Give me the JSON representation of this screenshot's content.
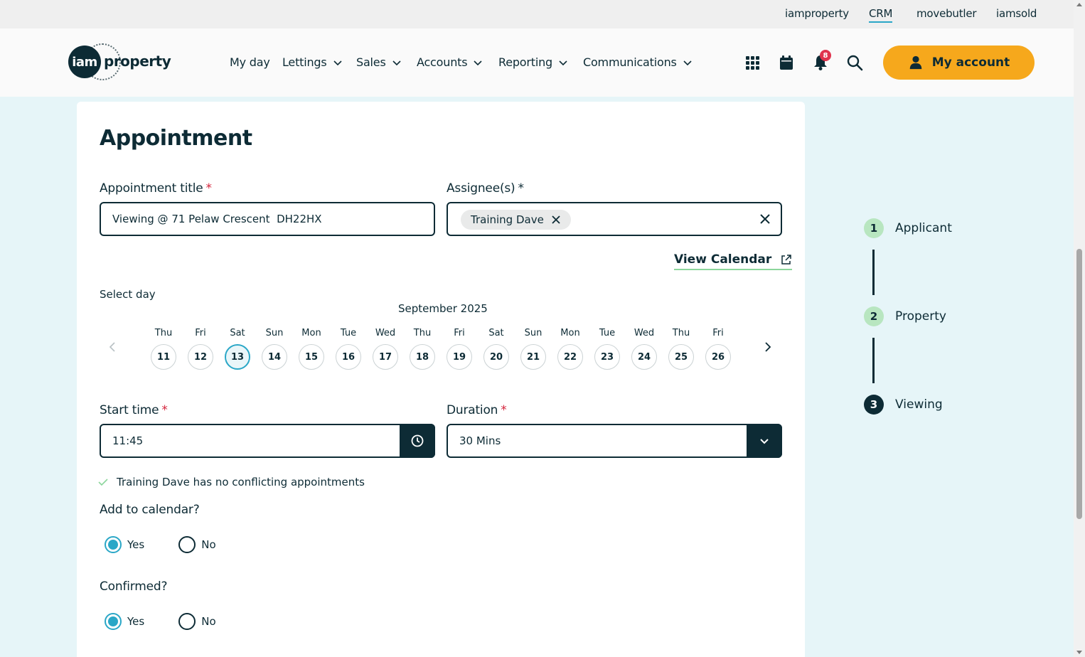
{
  "top_links": [
    "iamproperty",
    "CRM",
    "movebutler",
    "iamsold"
  ],
  "active_top_link": "CRM",
  "brand": {
    "circle_text": "iam",
    "text": "property"
  },
  "nav": {
    "my_day": "My day",
    "lettings": "Lettings",
    "sales": "Sales",
    "accounts": "Accounts",
    "reporting": "Reporting",
    "communications": "Communications"
  },
  "header_icons": [
    "apps-grid-icon",
    "calendar-icon",
    "bell-icon",
    "search-icon"
  ],
  "notifications_count": "8",
  "account_label": "My account",
  "colors": {
    "dark": "#0d2b35",
    "accent": "#f6a81c",
    "teal": "#2aa7c7",
    "success": "#8cd69c",
    "required": "#d4243b",
    "page_bg": "#e6f5f8"
  },
  "form": {
    "heading": "Appointment",
    "title_label": "Appointment title",
    "title_value": "Viewing @ 71 Pelaw Crescent  DH22HX",
    "assignee_label": "Assignee(s)",
    "assignee_chip": "Training Dave",
    "view_calendar": "View Calendar",
    "select_day_label": "Select day",
    "month": "September 2025",
    "days": [
      {
        "name": "Thu",
        "num": "11"
      },
      {
        "name": "Fri",
        "num": "12"
      },
      {
        "name": "Sat",
        "num": "13"
      },
      {
        "name": "Sun",
        "num": "14"
      },
      {
        "name": "Mon",
        "num": "15"
      },
      {
        "name": "Tue",
        "num": "16"
      },
      {
        "name": "Wed",
        "num": "17"
      },
      {
        "name": "Thu",
        "num": "18"
      },
      {
        "name": "Fri",
        "num": "19"
      },
      {
        "name": "Sat",
        "num": "20"
      },
      {
        "name": "Sun",
        "num": "21"
      },
      {
        "name": "Mon",
        "num": "22"
      },
      {
        "name": "Tue",
        "num": "23"
      },
      {
        "name": "Wed",
        "num": "24"
      },
      {
        "name": "Thu",
        "num": "25"
      },
      {
        "name": "Fri",
        "num": "26"
      }
    ],
    "selected_day": "13",
    "start_time_label": "Start time",
    "start_time_value": "11:45",
    "duration_label": "Duration",
    "duration_value": "30 Mins",
    "conflict_text": "Training Dave has no conflicting appointments",
    "add_to_calendar_label": "Add to calendar?",
    "add_to_calendar_value": "Yes",
    "confirmed_label": "Confirmed?",
    "confirmed_value": "Yes",
    "yes_label": "Yes",
    "no_label": "No"
  },
  "steps": [
    {
      "num": "1",
      "label": "Applicant",
      "state": "done"
    },
    {
      "num": "2",
      "label": "Property",
      "state": "done"
    },
    {
      "num": "3",
      "label": "Viewing",
      "state": "current"
    }
  ]
}
